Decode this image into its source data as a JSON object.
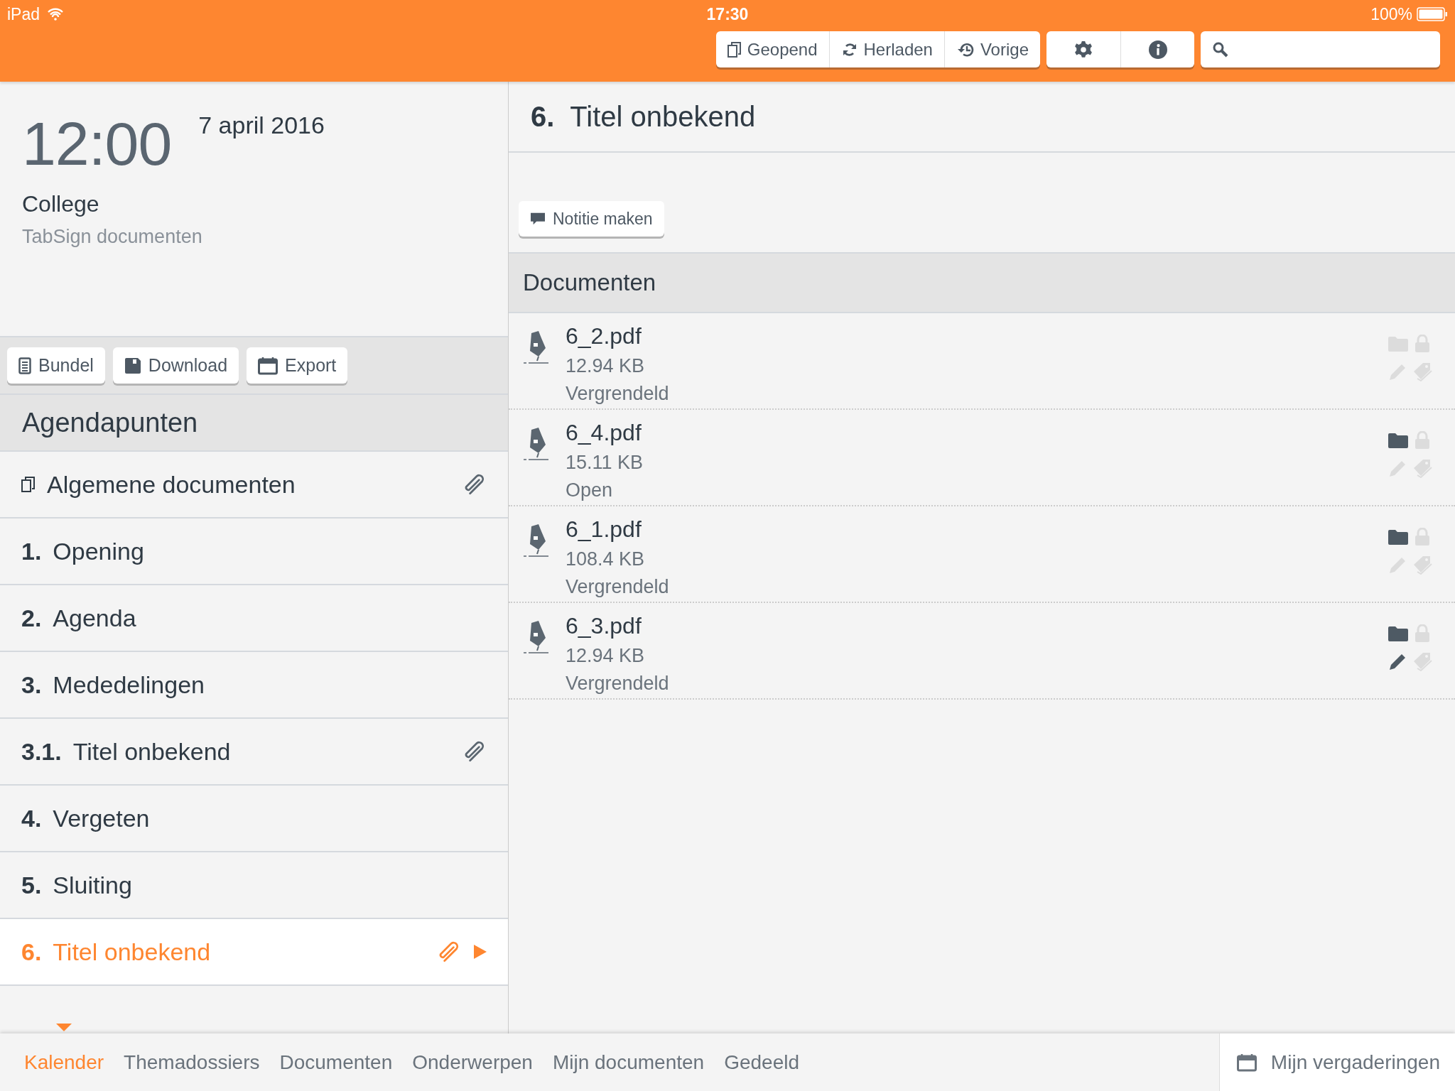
{
  "status_bar": {
    "device": "iPad",
    "time": "17:30",
    "battery": "100%"
  },
  "toolbar": {
    "buttons": [
      {
        "label": "Geopend"
      },
      {
        "label": "Herladen"
      },
      {
        "label": "Vorige"
      }
    ]
  },
  "meeting": {
    "time": "12:00",
    "date": "7 april 2016",
    "title": "College",
    "subtitle": "TabSign documenten"
  },
  "actions": [
    {
      "label": "Bundel"
    },
    {
      "label": "Download"
    },
    {
      "label": "Export"
    }
  ],
  "agenda": {
    "heading": "Agendapunten",
    "items": [
      {
        "kind": "general",
        "title": "Algemene documenten",
        "attachment": true,
        "selected": false
      },
      {
        "kind": "item",
        "number": "1.",
        "title": "Opening",
        "attachment": false,
        "selected": false
      },
      {
        "kind": "item",
        "number": "2.",
        "title": "Agenda",
        "attachment": false,
        "selected": false
      },
      {
        "kind": "item",
        "number": "3.",
        "title": "Mededelingen",
        "attachment": false,
        "selected": false
      },
      {
        "kind": "item",
        "number": "3.1.",
        "title": "Titel onbekend",
        "attachment": true,
        "selected": false
      },
      {
        "kind": "item",
        "number": "4.",
        "title": "Vergeten",
        "attachment": false,
        "selected": false
      },
      {
        "kind": "item",
        "number": "5.",
        "title": "Sluiting",
        "attachment": false,
        "selected": false
      },
      {
        "kind": "item",
        "number": "6.",
        "title": "Titel onbekend",
        "attachment": true,
        "selected": true
      }
    ]
  },
  "detail": {
    "number": "6.",
    "title": "Titel onbekend",
    "note_button": "Notitie maken",
    "documents_heading": "Documenten",
    "documents": [
      {
        "name": "6_2.pdf",
        "size": "12.94 KB",
        "status": "Vergrendeld",
        "in_folder": false,
        "locked": false,
        "annotated": false,
        "tagged": false
      },
      {
        "name": "6_4.pdf",
        "size": "15.11 KB",
        "status": "Open",
        "in_folder": true,
        "locked": false,
        "annotated": false,
        "tagged": false
      },
      {
        "name": "6_1.pdf",
        "size": "108.4 KB",
        "status": "Vergrendeld",
        "in_folder": true,
        "locked": false,
        "annotated": false,
        "tagged": false
      },
      {
        "name": "6_3.pdf",
        "size": "12.94 KB",
        "status": "Vergrendeld",
        "in_folder": true,
        "locked": false,
        "annotated": true,
        "tagged": false
      }
    ]
  },
  "bottom_tabs": [
    {
      "label": "Kalender",
      "selected": true
    },
    {
      "label": "Themadossiers",
      "selected": false
    },
    {
      "label": "Documenten",
      "selected": false
    },
    {
      "label": "Onderwerpen",
      "selected": false
    },
    {
      "label": "Mijn documenten",
      "selected": false
    },
    {
      "label": "Gedeeld",
      "selected": false
    }
  ],
  "my_meetings": "Mijn vergaderingen"
}
